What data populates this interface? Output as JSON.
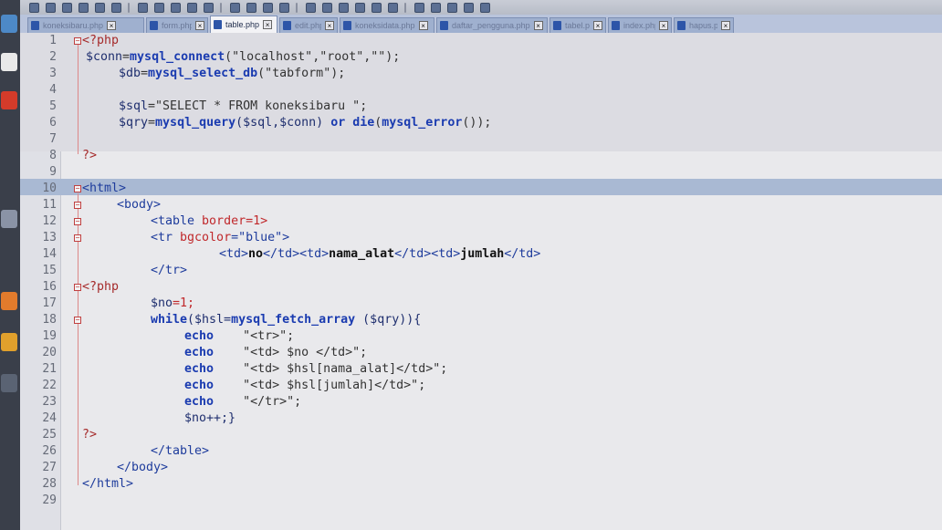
{
  "tabs": [
    {
      "label": "koneksibaru.php",
      "active": false
    },
    {
      "label": "form.php",
      "active": false
    },
    {
      "label": "table.php",
      "active": true
    },
    {
      "label": "edit.php",
      "active": false
    },
    {
      "label": "koneksidata.php",
      "active": false
    },
    {
      "label": "daftar_pengguna.php",
      "active": false
    },
    {
      "label": "tabel.php",
      "active": false
    },
    {
      "label": "index.php",
      "active": false
    },
    {
      "label": "hapus.php",
      "active": false
    }
  ],
  "line_numbers": [
    "1",
    "2",
    "3",
    "4",
    "5",
    "6",
    "7",
    "8",
    "9",
    "10",
    "11",
    "12",
    "13",
    "14",
    "15",
    "16",
    "17",
    "18",
    "19",
    "20",
    "21",
    "22",
    "23",
    "24",
    "25",
    "26",
    "27",
    "28",
    "29"
  ],
  "code": {
    "l1_open": "<?php",
    "l2_var": "$conn",
    "l2_eq": "=",
    "l2_fn": "mysql_connect",
    "l2_args": "(\"localhost\",\"root\",\"\");",
    "l3_var": "$db",
    "l3_eq": "=",
    "l3_fn": "mysql_select_db",
    "l3_args": "(\"tabform\");",
    "l5_var": "$sql",
    "l5_rest": "=\"SELECT * FROM koneksibaru \";",
    "l6_var": "$qry",
    "l6_eq": "=",
    "l6_fn": "mysql_query",
    "l6_args": "($sql,$conn) ",
    "l6_or": "or",
    "l6_die": "die",
    "l6_p1": "(",
    "l6_err": "mysql_error",
    "l6_p2": "());",
    "l8_close": "?>",
    "l10": "<html>",
    "l11": "<body>",
    "l12_tag": "<table ",
    "l12_attr": "border",
    "l12_val": "=1>",
    "l13_tag": "<tr ",
    "l13_attr": "bgcolor",
    "l13_val": "=\"blue\">",
    "l14_a": "<td>",
    "l14_b": "no",
    "l14_c": "</td><td>",
    "l14_d": "nama_alat",
    "l14_e": "</td><td>",
    "l14_f": "jumlah",
    "l14_g": "</td>",
    "l15": "</tr>",
    "l16_open": "<?php",
    "l17_var": "$no",
    "l17_rest": "=1;",
    "l18_kw": "while",
    "l18_a": "($hsl=",
    "l18_fn": "mysql_fetch_array",
    "l18_b": " ($qry)){",
    "l19_kw": "echo",
    "l19_str": "\"<tr>\";",
    "l20_kw": "echo",
    "l20_str": "\"<td> $no </td>\";",
    "l21_kw": "echo",
    "l21_str": "\"<td> $hsl[nama_alat]</td>\";",
    "l22_kw": "echo",
    "l22_str": "\"<td> $hsl[jumlah]</td>\";",
    "l23_kw": "echo",
    "l23_str": "\"</tr>\";",
    "l24": "$no++;}",
    "l25_close": "?>",
    "l26": "</table>",
    "l27": "</body>",
    "l28": "</html>"
  },
  "colors": {
    "editor_bg": "#e9e9ec",
    "current_line": "#a9b9d3",
    "keyword": "#1a3bb0",
    "php_tag": "#a52a2a",
    "attribute": "#c0282b"
  }
}
